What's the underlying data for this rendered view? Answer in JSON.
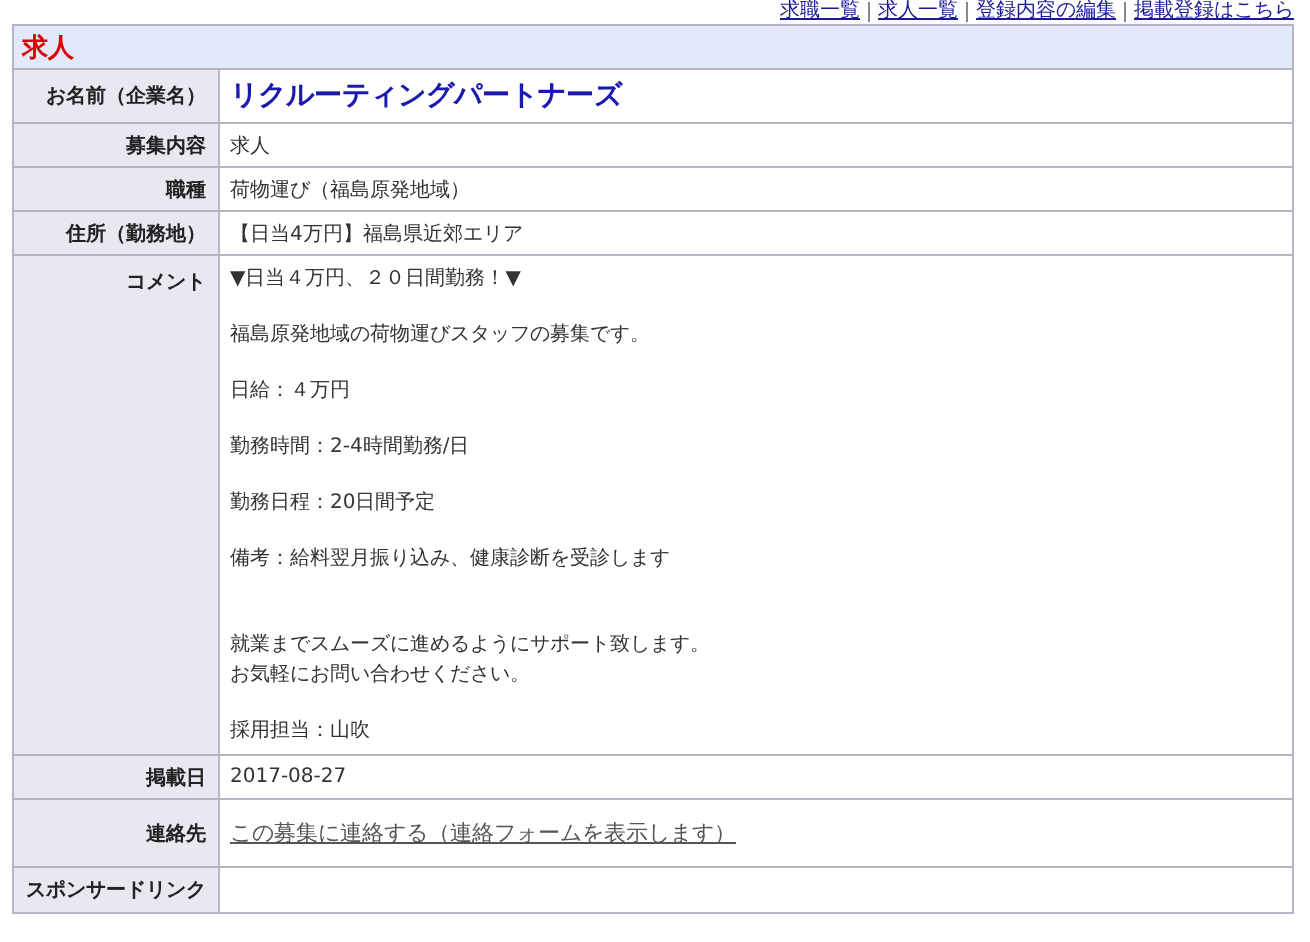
{
  "top_links": [
    "求職一覧",
    "求人一覧",
    "登録内容の編集",
    "掲載登録はこちら"
  ],
  "section_title": "求人",
  "rows": [
    {
      "label": "お名前（企業名）",
      "kind": "company",
      "value": "リクルーティングパートナーズ"
    },
    {
      "label": "募集内容",
      "kind": "text",
      "value": "求人"
    },
    {
      "label": "職種",
      "kind": "text",
      "value": "荷物運び（福島原発地域）"
    },
    {
      "label": "住所（勤務地）",
      "kind": "text",
      "value": "【日当4万円】福島県近郊エリア"
    },
    {
      "label": "コメント",
      "kind": "comment",
      "paragraphs": [
        {
          "kind": "normal",
          "lines": [
            "▼日当４万円、２０日間勤務！▼"
          ]
        },
        {
          "kind": "normal",
          "lines": [
            "福島原発地域の荷物運びスタッフの募集です。"
          ]
        },
        {
          "kind": "normal",
          "lines": [
            "日給：４万円"
          ]
        },
        {
          "kind": "normal",
          "lines": [
            "勤務時間：2-4時間勤務/日"
          ]
        },
        {
          "kind": "normal",
          "lines": [
            "勤務日程：20日間予定"
          ]
        },
        {
          "kind": "normal",
          "lines": [
            "備考：給料翌月振り込み、健康診断を受診します"
          ]
        },
        {
          "kind": "spaced",
          "lines": [
            "就業までスムーズに進めるようにサポート致します。",
            "お気軽にお問い合わせください。"
          ]
        },
        {
          "kind": "normal",
          "lines": [
            "採用担当：山吹"
          ]
        }
      ]
    },
    {
      "label": "掲載日",
      "kind": "text",
      "value": "2017-08-27"
    },
    {
      "label": "連絡先",
      "kind": "link",
      "value": "この募集に連絡する（連絡フォームを表示します）"
    },
    {
      "label": "スポンサードリンク",
      "kind": "empty"
    }
  ]
}
